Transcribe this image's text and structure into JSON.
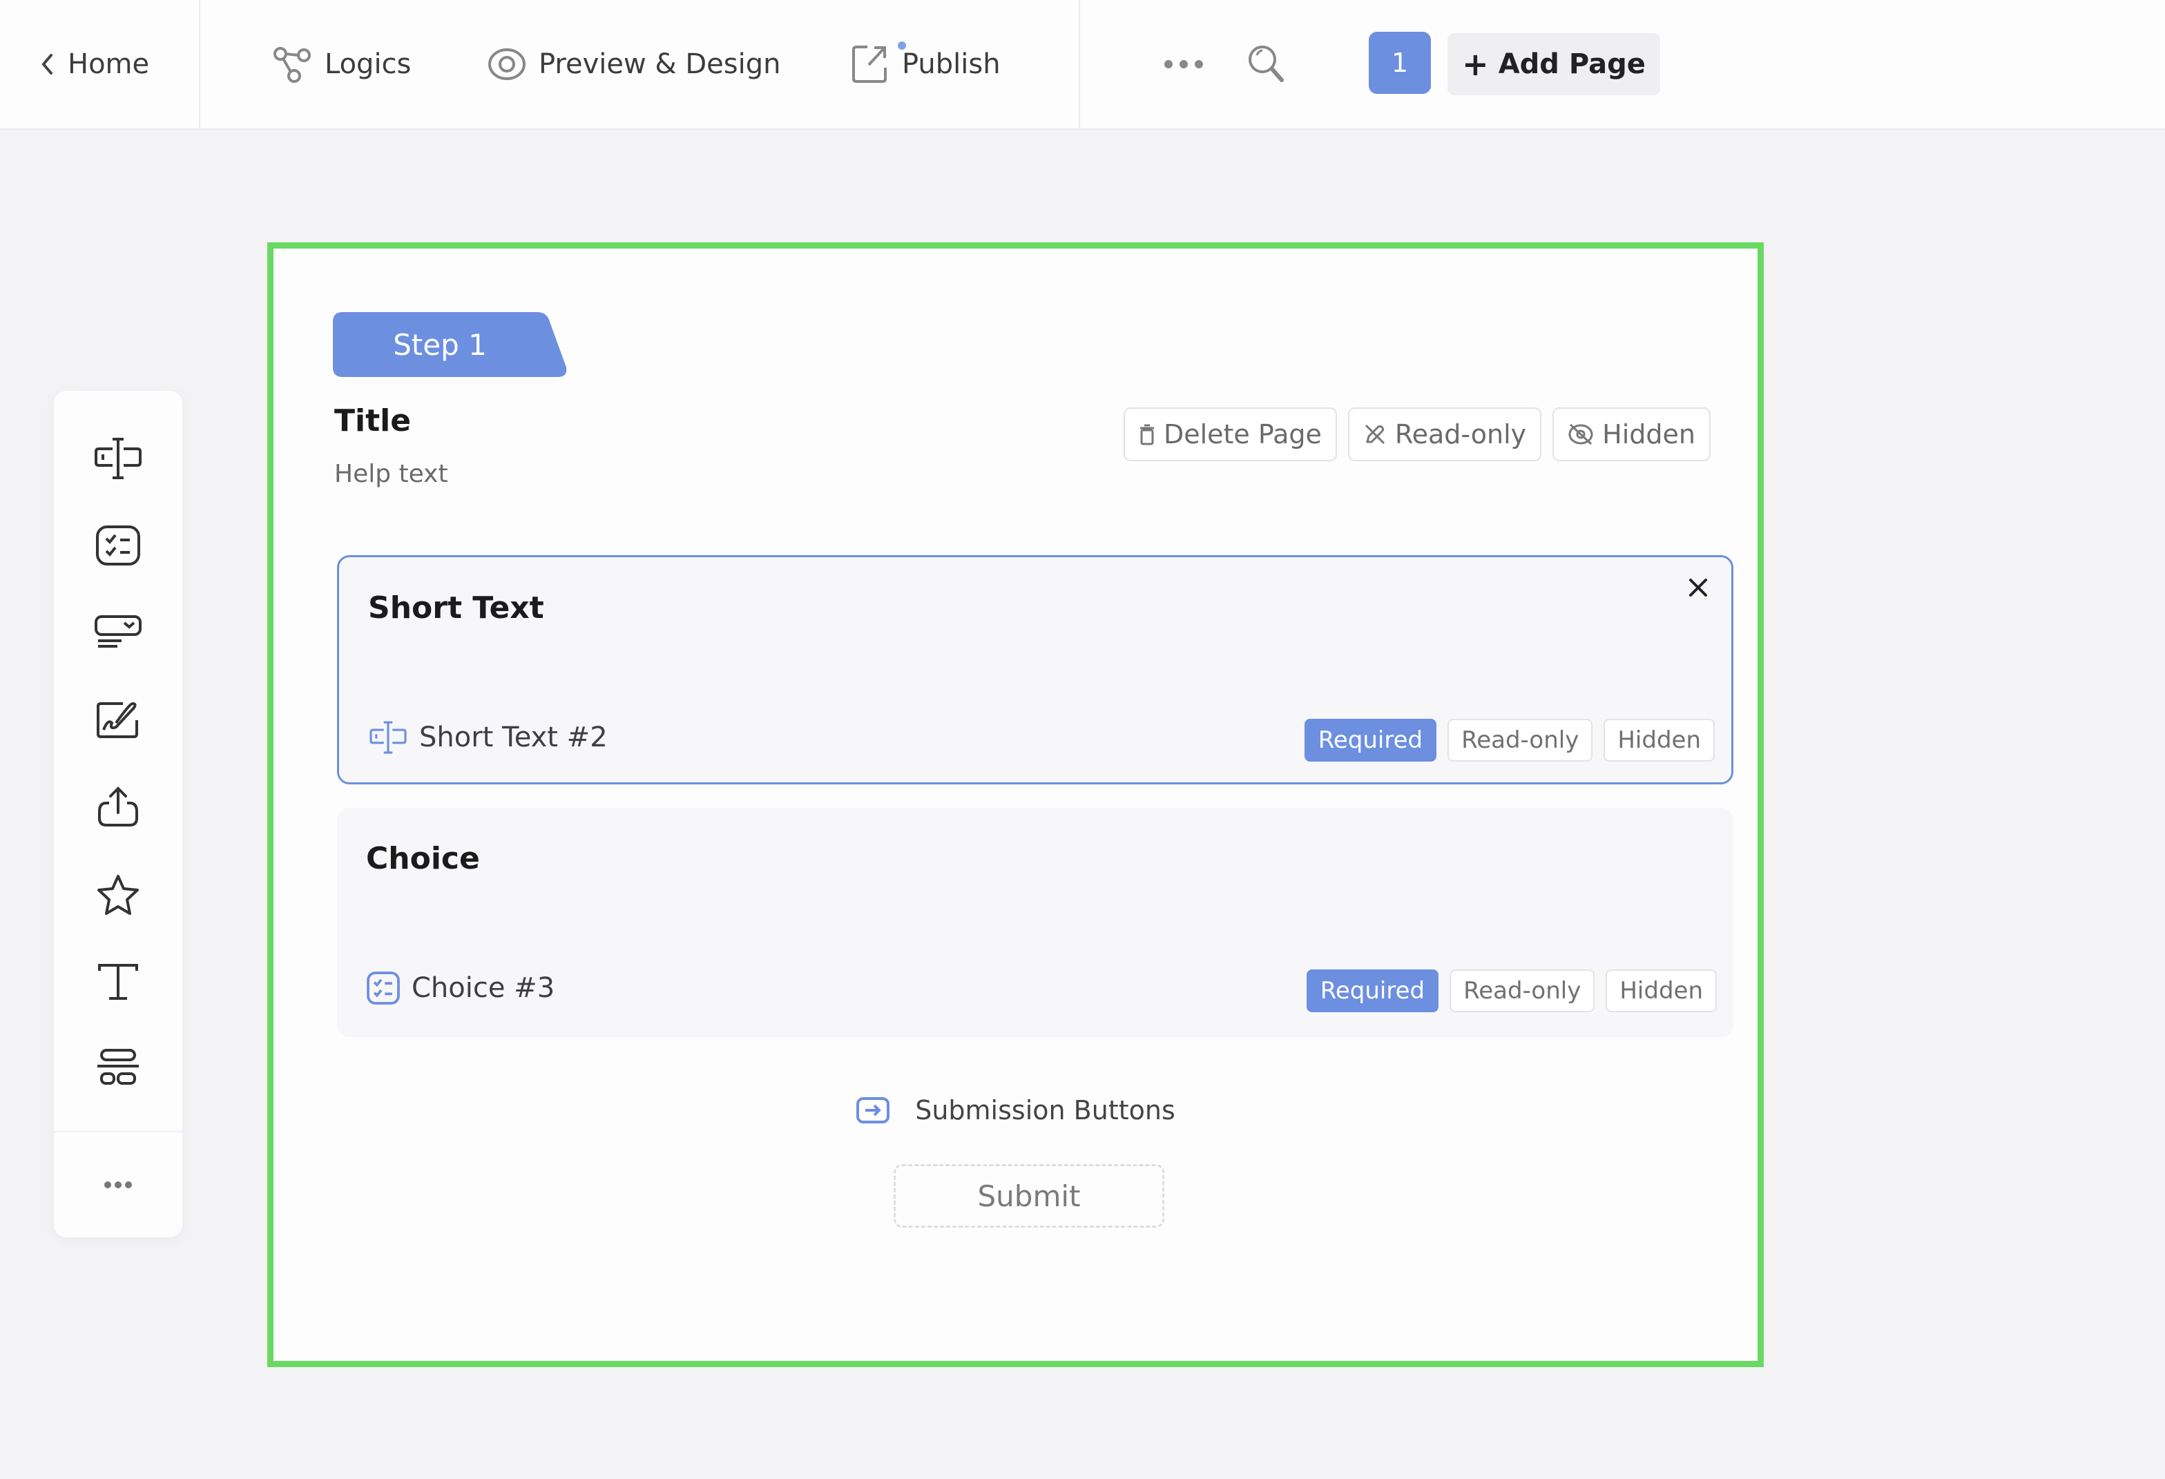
{
  "topbar": {
    "home_label": "Home",
    "logics_label": "Logics",
    "preview_label": "Preview & Design",
    "publish_label": "Publish",
    "page_number": "1",
    "add_page_label": "Add Page",
    "icons": {
      "home": "chevron-left-icon",
      "logics": "branch-icon",
      "preview": "eye-icon",
      "publish": "external-link-icon",
      "more": "ellipsis-icon",
      "search": "search-icon",
      "add": "plus-icon"
    }
  },
  "palette": {
    "items": [
      {
        "name": "short-text",
        "icon": "text-input-icon"
      },
      {
        "name": "choice",
        "icon": "checklist-icon"
      },
      {
        "name": "dropdown",
        "icon": "dropdown-icon"
      },
      {
        "name": "signature",
        "icon": "signature-icon"
      },
      {
        "name": "upload",
        "icon": "upload-icon"
      },
      {
        "name": "rating",
        "icon": "star-icon"
      },
      {
        "name": "text",
        "icon": "text-icon"
      },
      {
        "name": "layout",
        "icon": "layout-icon"
      }
    ],
    "more_icon": "ellipsis-icon"
  },
  "page": {
    "step_label": "Step 1",
    "title": "Title",
    "help_text": "Help text",
    "actions": {
      "delete": "Delete Page",
      "readonly": "Read-only",
      "hidden": "Hidden"
    }
  },
  "fields": [
    {
      "title": "Short Text",
      "name": "Short Text #2",
      "type_icon": "text-input-icon",
      "active": true,
      "toggles": {
        "required": "Required",
        "readonly": "Read-only",
        "hidden": "Hidden"
      },
      "required_on": true
    },
    {
      "title": "Choice",
      "name": "Choice #3",
      "type_icon": "checklist-icon",
      "active": false,
      "toggles": {
        "required": "Required",
        "readonly": "Read-only",
        "hidden": "Hidden"
      },
      "required_on": true
    }
  ],
  "submission": {
    "label": "Submission Buttons",
    "submit_label": "Submit"
  },
  "colors": {
    "accent": "#6c8fe0",
    "canvas_border": "#69d964",
    "background": "#f3f3f5"
  }
}
